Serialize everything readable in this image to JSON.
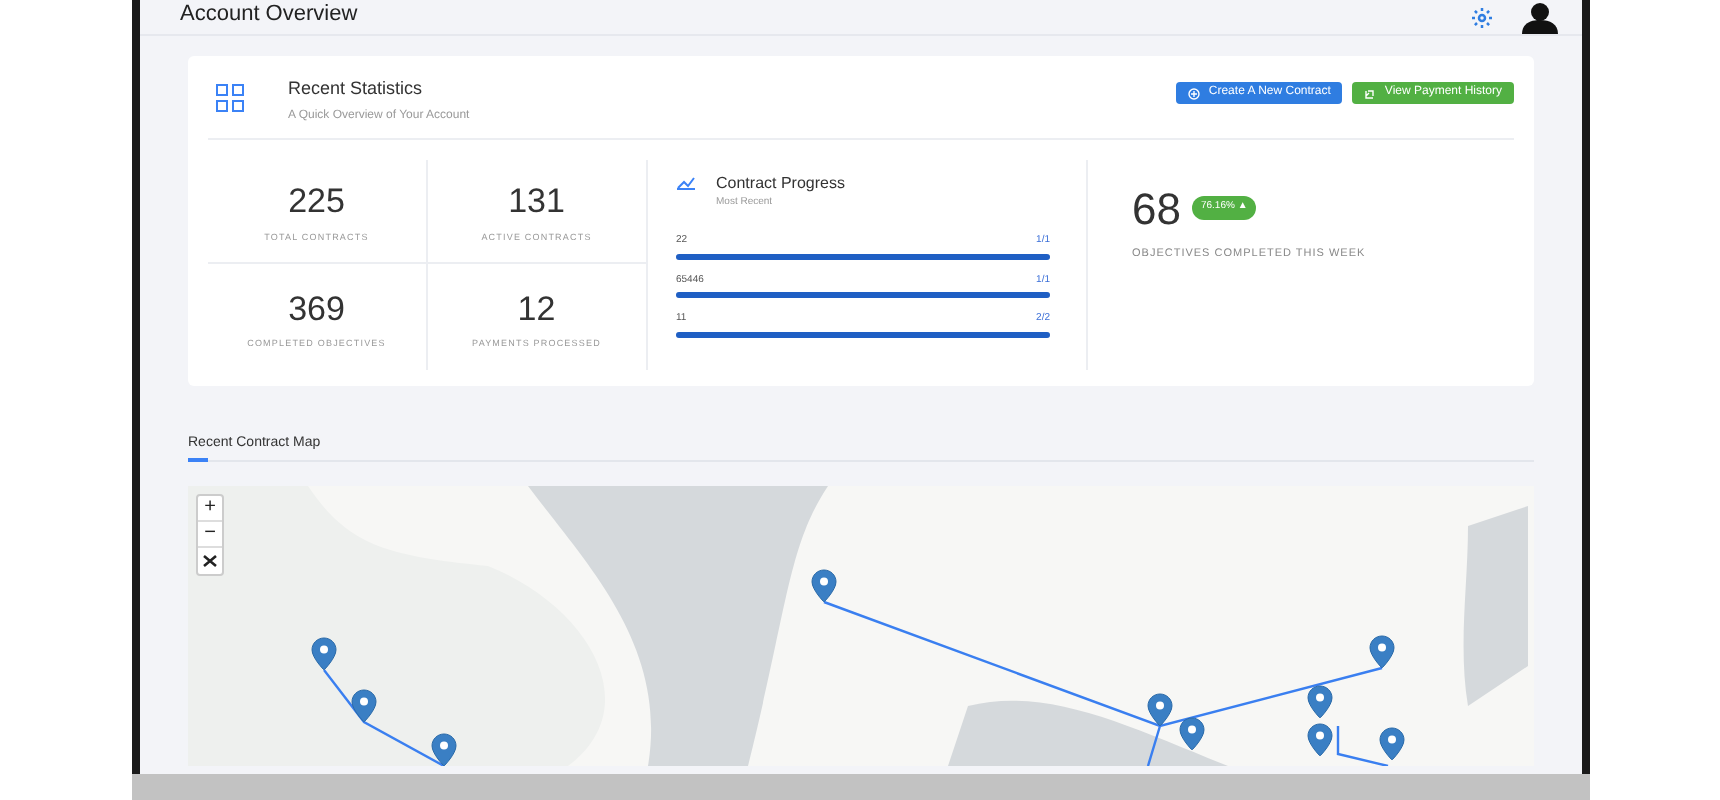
{
  "header": {
    "title": "Account Overview"
  },
  "stats_card": {
    "title": "Recent Statistics",
    "subtitle": "A Quick Overview of Your Account",
    "buttons": [
      {
        "label": "Create A New Contract",
        "kind": "primary"
      },
      {
        "label": "View Payment History",
        "kind": "success"
      }
    ],
    "stats": [
      {
        "value": "225",
        "label": "TOTAL CONTRACTS"
      },
      {
        "value": "131",
        "label": "ACTIVE CONTRACTS"
      },
      {
        "value": "369",
        "label": "COMPLETED OBJECTIVES"
      },
      {
        "value": "12",
        "label": "PAYMENTS PROCESSED"
      }
    ],
    "progress": {
      "title": "Contract Progress",
      "subtitle": "Most Recent",
      "items": [
        {
          "name": "22",
          "count": "1/1",
          "level": 1
        },
        {
          "name": "65446",
          "count": "1/1",
          "level": 1
        },
        {
          "name": "11",
          "count": "2/2",
          "level": 1
        }
      ]
    },
    "objectives": {
      "value": "68",
      "badge": "76.16% ▲",
      "label": "OBJECTIVES COMPLETED THIS WEEK"
    }
  },
  "map_section": {
    "title": "Recent Contract Map",
    "zoom_controls": [
      "+",
      "−"
    ]
  }
}
